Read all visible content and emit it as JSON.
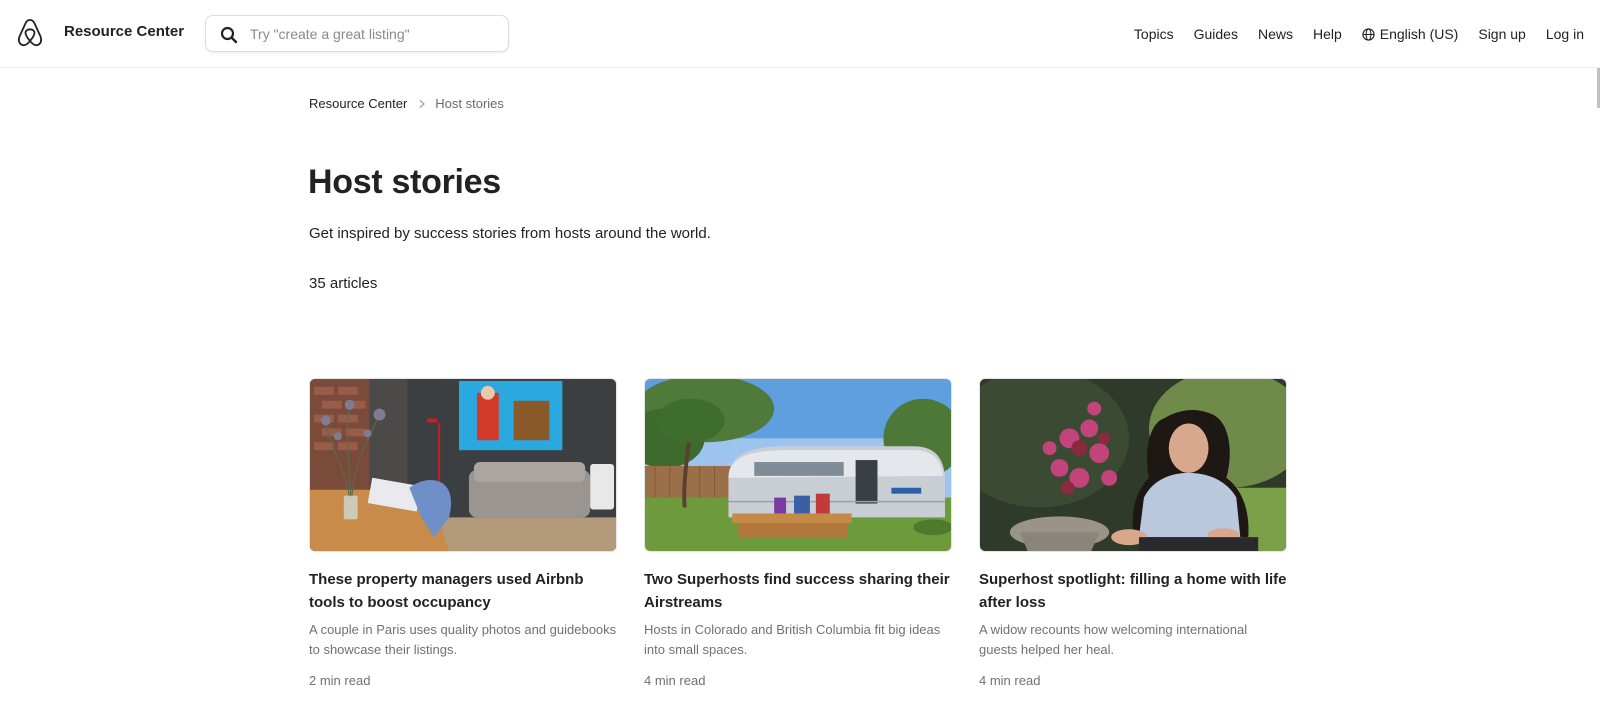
{
  "header": {
    "brand": "Resource Center",
    "search_placeholder": "Try \"create a great listing\"",
    "nav": {
      "topics": "Topics",
      "guides": "Guides",
      "news": "News",
      "help": "Help",
      "language": "English (US)",
      "signup": "Sign up",
      "login": "Log in"
    }
  },
  "breadcrumb": {
    "root": "Resource Center",
    "current": "Host stories"
  },
  "page": {
    "title": "Host stories",
    "subtitle": "Get inspired by success stories from hosts around the world.",
    "count": "35 articles"
  },
  "articles": [
    {
      "title": "These property managers used Airbnb tools to boost occupancy",
      "description": "A couple in Paris uses quality photos and guidebooks to showcase their listings.",
      "read_time": "2 min read"
    },
    {
      "title": "Two Superhosts find success sharing their Airstreams",
      "description": "Hosts in Colorado and British Columbia fit big ideas into small spaces.",
      "read_time": "4 min read"
    },
    {
      "title": "Superhost spotlight: filling a home with life after loss",
      "description": "A widow recounts how welcoming international guests helped her heal.",
      "read_time": "4 min read"
    }
  ],
  "icons": {
    "logo": "airbnb-logo-icon",
    "search": "search-icon",
    "globe": "globe-icon",
    "breadcrumb_separator": "chevron-right-icon"
  }
}
